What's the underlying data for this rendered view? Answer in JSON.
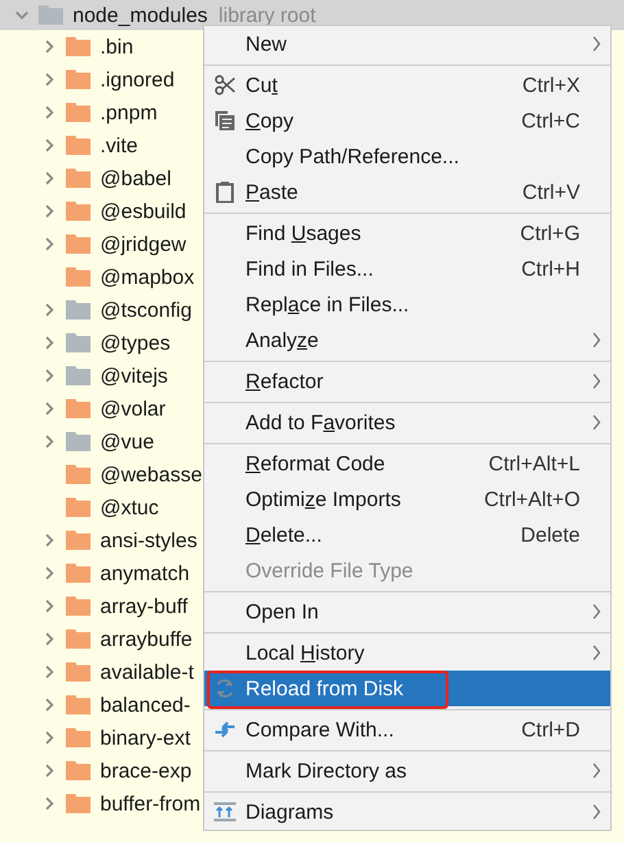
{
  "tree": {
    "root": {
      "name": "node_modules",
      "note": "library root",
      "expanded": true,
      "color": "#afb8bd"
    },
    "children": [
      {
        "name": ".bin",
        "expandable": true,
        "color": "#f5a36e"
      },
      {
        "name": ".ignored",
        "expandable": true,
        "color": "#f5a36e"
      },
      {
        "name": ".pnpm",
        "expandable": true,
        "color": "#f5a36e"
      },
      {
        "name": ".vite",
        "expandable": true,
        "color": "#f5a36e"
      },
      {
        "name": "@babel",
        "expandable": true,
        "color": "#f5a36e"
      },
      {
        "name": "@esbuild",
        "expandable": true,
        "color": "#f5a36e"
      },
      {
        "name": "@jridgew",
        "expandable": true,
        "color": "#f5a36e"
      },
      {
        "name": "@mapbox",
        "expandable": false,
        "color": "#f5a36e"
      },
      {
        "name": "@tsconfig",
        "expandable": true,
        "color": "#afb8bd"
      },
      {
        "name": "@types",
        "expandable": true,
        "color": "#afb8bd"
      },
      {
        "name": "@vitejs",
        "expandable": true,
        "color": "#afb8bd"
      },
      {
        "name": "@volar",
        "expandable": true,
        "color": "#f5a36e"
      },
      {
        "name": "@vue",
        "expandable": true,
        "color": "#afb8bd"
      },
      {
        "name": "@webasse",
        "expandable": false,
        "color": "#f5a36e"
      },
      {
        "name": "@xtuc",
        "expandable": false,
        "color": "#f5a36e"
      },
      {
        "name": "ansi-styles",
        "expandable": true,
        "color": "#f5a36e"
      },
      {
        "name": "anymatch",
        "expandable": true,
        "color": "#f5a36e"
      },
      {
        "name": "array-buff",
        "expandable": true,
        "color": "#f5a36e"
      },
      {
        "name": "arraybuffe",
        "expandable": true,
        "color": "#f5a36e"
      },
      {
        "name": "available-t",
        "expandable": true,
        "color": "#f5a36e"
      },
      {
        "name": "balanced-",
        "expandable": true,
        "color": "#f5a36e"
      },
      {
        "name": "binary-ext",
        "expandable": true,
        "color": "#f5a36e"
      },
      {
        "name": "brace-exp",
        "expandable": true,
        "color": "#f5a36e"
      },
      {
        "name": "buffer-from",
        "expandable": true,
        "color": "#f5a36e"
      }
    ]
  },
  "context_menu": {
    "items": [
      {
        "kind": "item",
        "label": {
          "pre": "New"
        },
        "submenu": true,
        "selected": false,
        "disabled": false
      },
      {
        "kind": "separator"
      },
      {
        "kind": "item",
        "label": {
          "pre": "Cu",
          "key": "t"
        },
        "shortcut": "Ctrl+X",
        "selected": false,
        "disabled": false
      },
      {
        "kind": "item",
        "label": {
          "key": "C",
          "post": "opy"
        },
        "shortcut": "Ctrl+C",
        "selected": false,
        "disabled": false
      },
      {
        "kind": "item",
        "label": {
          "pre": "Copy Path/Reference..."
        },
        "selected": false,
        "disabled": false
      },
      {
        "kind": "item",
        "label": {
          "key": "P",
          "post": "aste"
        },
        "shortcut": "Ctrl+V",
        "selected": false,
        "disabled": false
      },
      {
        "kind": "separator"
      },
      {
        "kind": "item",
        "label": {
          "pre": "Find ",
          "key": "U",
          "post": "sages"
        },
        "shortcut": "Ctrl+G",
        "selected": false,
        "disabled": false
      },
      {
        "kind": "item",
        "label": {
          "pre": "Find in Files..."
        },
        "shortcut": "Ctrl+H",
        "selected": false,
        "disabled": false
      },
      {
        "kind": "item",
        "label": {
          "pre": "Repl",
          "key": "a",
          "post": "ce in Files..."
        },
        "selected": false,
        "disabled": false
      },
      {
        "kind": "item",
        "label": {
          "pre": "Analy",
          "key": "z",
          "post": "e"
        },
        "submenu": true,
        "selected": false,
        "disabled": false
      },
      {
        "kind": "separator"
      },
      {
        "kind": "item",
        "label": {
          "key": "R",
          "post": "efactor"
        },
        "submenu": true,
        "selected": false,
        "disabled": false
      },
      {
        "kind": "separator"
      },
      {
        "kind": "item",
        "label": {
          "pre": "Add to F",
          "key": "a",
          "post": "vorites"
        },
        "submenu": true,
        "selected": false,
        "disabled": false
      },
      {
        "kind": "separator"
      },
      {
        "kind": "item",
        "label": {
          "key": "R",
          "post": "eformat Code"
        },
        "shortcut": "Ctrl+Alt+L",
        "selected": false,
        "disabled": false
      },
      {
        "kind": "item",
        "label": {
          "pre": "Optimi",
          "key": "z",
          "post": "e Imports"
        },
        "shortcut": "Ctrl+Alt+O",
        "selected": false,
        "disabled": false
      },
      {
        "kind": "item",
        "label": {
          "key": "D",
          "post": "elete..."
        },
        "shortcut": "Delete",
        "selected": false,
        "disabled": false
      },
      {
        "kind": "item",
        "label": {
          "pre": "Override File Type"
        },
        "selected": false,
        "disabled": true
      },
      {
        "kind": "separator"
      },
      {
        "kind": "item",
        "label": {
          "pre": "Open In"
        },
        "submenu": true,
        "selected": false,
        "disabled": false
      },
      {
        "kind": "separator"
      },
      {
        "kind": "item",
        "label": {
          "pre": "Local ",
          "key": "H",
          "post": "istory"
        },
        "submenu": true,
        "selected": false,
        "disabled": false
      },
      {
        "kind": "item",
        "label": {
          "pre": "Reload from Disk"
        },
        "selected": true,
        "disabled": false,
        "annotated": true
      },
      {
        "kind": "separator"
      },
      {
        "kind": "item",
        "label": {
          "pre": "Compare With..."
        },
        "shortcut": "Ctrl+D",
        "selected": false,
        "disabled": false
      },
      {
        "kind": "separator"
      },
      {
        "kind": "item",
        "label": {
          "pre": "Mark Directory as"
        },
        "submenu": true,
        "selected": false,
        "disabled": false
      },
      {
        "kind": "separator"
      },
      {
        "kind": "item",
        "label": {
          "pre": "Diagrams"
        },
        "submenu": true,
        "selected": false,
        "disabled": false
      }
    ]
  }
}
